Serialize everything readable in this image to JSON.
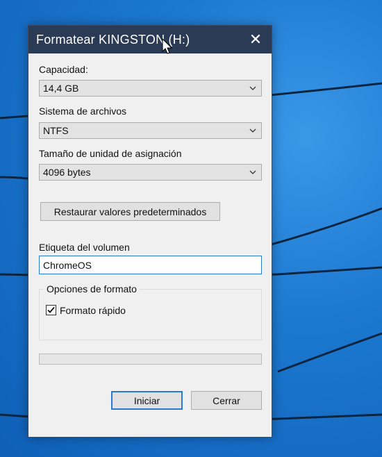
{
  "window": {
    "title": "Formatear KINGSTON (H:)",
    "close_glyph": "✕"
  },
  "capacity": {
    "label": "Capacidad:",
    "value": "14,4 GB"
  },
  "filesystem": {
    "label": "Sistema de archivos",
    "value": "NTFS"
  },
  "allocation": {
    "label": "Tamaño de unidad de asignación",
    "value": "4096 bytes"
  },
  "restore_button": "Restaurar valores predeterminados",
  "volume_label": {
    "label": "Etiqueta del volumen",
    "value": "ChromeOS"
  },
  "format_options": {
    "title": "Opciones de formato",
    "quick_format_label": "Formato rápido",
    "quick_format_checked": true
  },
  "progress": {
    "fraction": 0
  },
  "buttons": {
    "start": "Iniciar",
    "close": "Cerrar"
  },
  "colors": {
    "titlebar": "#2b3a55",
    "accent": "#2b79d0",
    "dialog_bg": "#f0f0f0",
    "desktop": "#1673c8"
  }
}
